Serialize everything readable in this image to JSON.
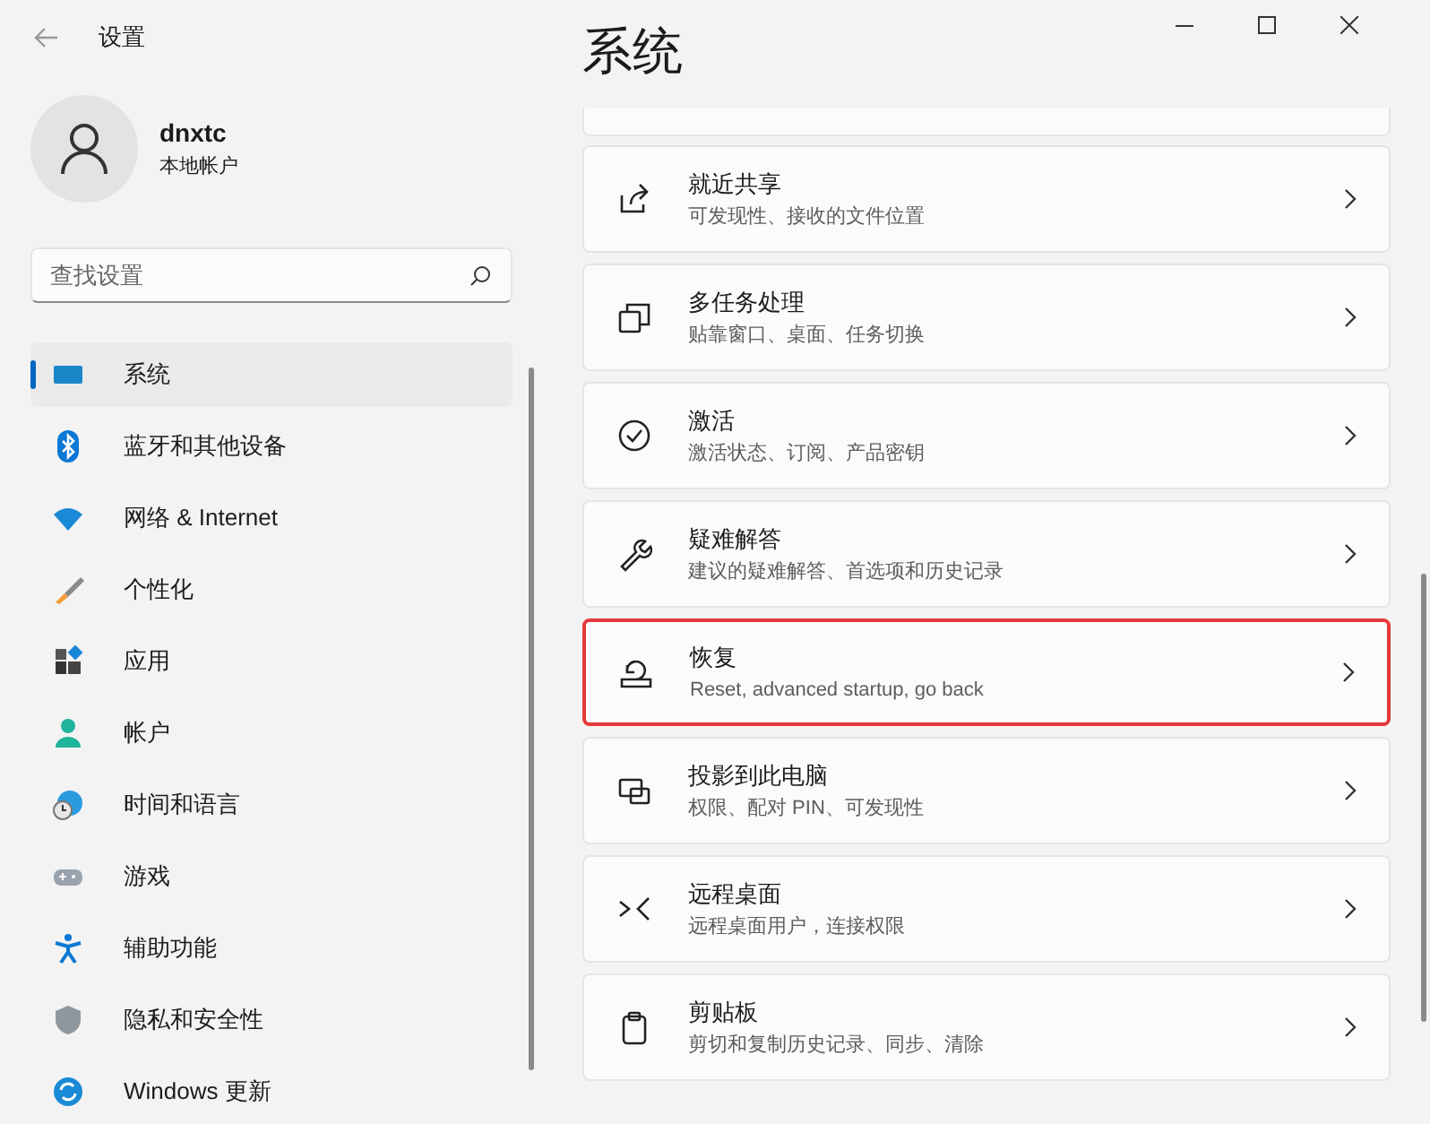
{
  "window": {
    "title": "设置"
  },
  "user": {
    "name": "dnxtc",
    "account": "本地帐户"
  },
  "search": {
    "placeholder": "查找设置"
  },
  "sidebar": {
    "items": [
      {
        "label": "系统",
        "kind": "system",
        "selected": true
      },
      {
        "label": "蓝牙和其他设备",
        "kind": "bluetooth",
        "selected": false
      },
      {
        "label": "网络 & Internet",
        "kind": "network",
        "selected": false
      },
      {
        "label": "个性化",
        "kind": "brush",
        "selected": false
      },
      {
        "label": "应用",
        "kind": "apps",
        "selected": false
      },
      {
        "label": "帐户",
        "kind": "account",
        "selected": false
      },
      {
        "label": "时间和语言",
        "kind": "time",
        "selected": false
      },
      {
        "label": "游戏",
        "kind": "game",
        "selected": false
      },
      {
        "label": "辅助功能",
        "kind": "access",
        "selected": false
      },
      {
        "label": "隐私和安全性",
        "kind": "shield",
        "selected": false
      },
      {
        "label": "Windows 更新",
        "kind": "update",
        "selected": false
      }
    ]
  },
  "page": {
    "title": "系统"
  },
  "cards": [
    {
      "title": "就近共享",
      "subtitle": "可发现性、接收的文件位置",
      "kind": "share",
      "highlighted": false
    },
    {
      "title": "多任务处理",
      "subtitle": "贴靠窗口、桌面、任务切换",
      "kind": "multitask",
      "highlighted": false
    },
    {
      "title": "激活",
      "subtitle": "激活状态、订阅、产品密钥",
      "kind": "check",
      "highlighted": false
    },
    {
      "title": "疑难解答",
      "subtitle": "建议的疑难解答、首选项和历史记录",
      "kind": "wrench",
      "highlighted": false
    },
    {
      "title": "恢复",
      "subtitle": "Reset, advanced startup, go back",
      "kind": "recovery",
      "highlighted": true
    },
    {
      "title": "投影到此电脑",
      "subtitle": "权限、配对 PIN、可发现性",
      "kind": "project",
      "highlighted": false
    },
    {
      "title": "远程桌面",
      "subtitle": "远程桌面用户，连接权限",
      "kind": "remote",
      "highlighted": false
    },
    {
      "title": "剪贴板",
      "subtitle": "剪切和复制历史记录、同步、清除",
      "kind": "clipboard",
      "highlighted": false
    }
  ]
}
